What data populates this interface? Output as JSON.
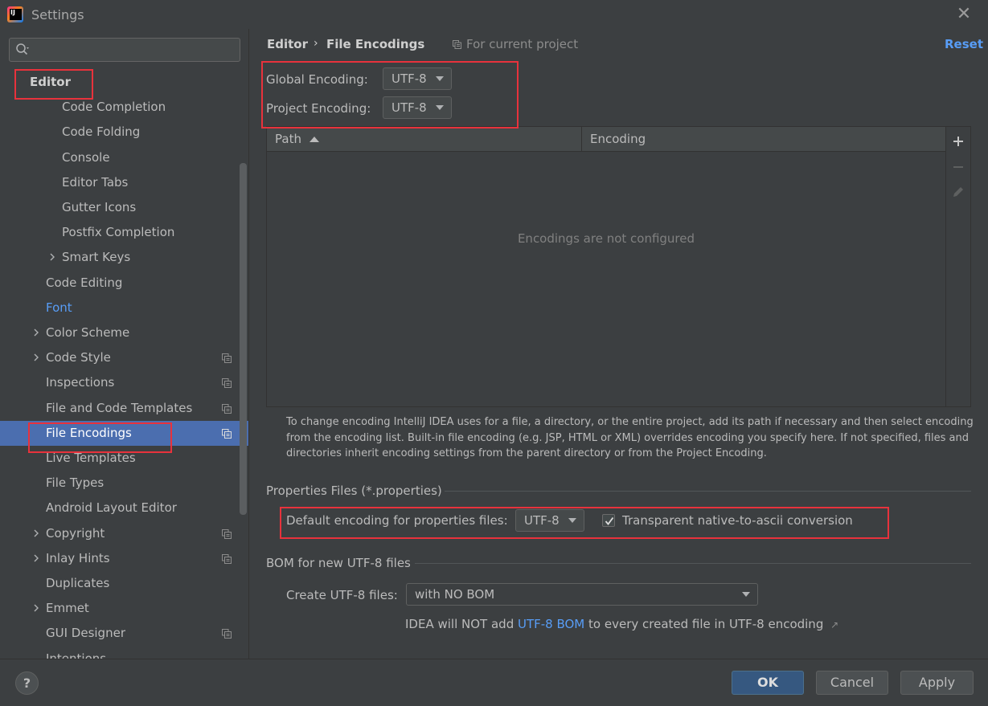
{
  "window": {
    "title": "Settings",
    "icon": "intellij-idea-icon",
    "close_icon": "close-icon"
  },
  "sidebar": {
    "search_placeholder": "",
    "root": "Editor",
    "items": [
      {
        "label": "Code Completion",
        "level": 2
      },
      {
        "label": "Code Folding",
        "level": 2
      },
      {
        "label": "Console",
        "level": 2
      },
      {
        "label": "Editor Tabs",
        "level": 2
      },
      {
        "label": "Gutter Icons",
        "level": 2
      },
      {
        "label": "Postfix Completion",
        "level": 2
      },
      {
        "label": "Smart Keys",
        "level": 2,
        "expandable": true
      },
      {
        "label": "Code Editing",
        "level": 1
      },
      {
        "label": "Font",
        "level": 1,
        "link": true
      },
      {
        "label": "Color Scheme",
        "level": 1,
        "expandable": true
      },
      {
        "label": "Code Style",
        "level": 1,
        "expandable": true,
        "project": true
      },
      {
        "label": "Inspections",
        "level": 1,
        "project": true
      },
      {
        "label": "File and Code Templates",
        "level": 1,
        "project": true
      },
      {
        "label": "File Encodings",
        "level": 1,
        "project": true,
        "selected": true
      },
      {
        "label": "Live Templates",
        "level": 1
      },
      {
        "label": "File Types",
        "level": 1
      },
      {
        "label": "Android Layout Editor",
        "level": 1
      },
      {
        "label": "Copyright",
        "level": 1,
        "expandable": true,
        "project": true
      },
      {
        "label": "Inlay Hints",
        "level": 1,
        "expandable": true,
        "project": true
      },
      {
        "label": "Duplicates",
        "level": 1
      },
      {
        "label": "Emmet",
        "level": 1,
        "expandable": true
      },
      {
        "label": "GUI Designer",
        "level": 1,
        "project": true
      },
      {
        "label": "Intentions",
        "level": 1
      }
    ]
  },
  "header": {
    "breadcrumb_parent": "Editor",
    "breadcrumb_separator": "›",
    "breadcrumb_current": "File Encodings",
    "scope": "For current project",
    "reset": "Reset"
  },
  "encodings": {
    "global_label": "Global Encoding:",
    "global_value": "UTF-8",
    "project_label": "Project Encoding:",
    "project_value": "UTF-8"
  },
  "table": {
    "columns": [
      "Path",
      "Encoding"
    ],
    "empty_text": "Encodings are not configured",
    "toolbar": [
      "add-icon",
      "remove-icon",
      "edit-icon"
    ]
  },
  "help_text": "To change encoding IntelliJ IDEA uses for a file, a directory, or the entire project, add its path if necessary and then select encoding from the encoding list. Built-in file encoding (e.g. JSP, HTML or XML) overrides encoding you specify here. If not specified, files and directories inherit encoding settings from the parent directory or from the Project Encoding.",
  "properties": {
    "section_title": "Properties Files (*.properties)",
    "default_label": "Default encoding for properties files:",
    "default_value": "UTF-8",
    "native_to_ascii_label": "Transparent native-to-ascii conversion",
    "native_to_ascii_checked": true
  },
  "bom": {
    "section_title": "BOM for new UTF-8 files",
    "create_label": "Create UTF-8 files:",
    "create_value": "with NO BOM",
    "info_prefix": "IDEA will NOT add ",
    "info_link": "UTF-8 BOM",
    "info_suffix": " to every created file in UTF-8 encoding"
  },
  "buttons": {
    "help": "?",
    "ok": "OK",
    "cancel": "Cancel",
    "apply": "Apply"
  },
  "colors": {
    "background": "#3c3f41",
    "selection": "#4b6eaf",
    "link": "#589df6",
    "highlight_box": "#e8323c",
    "default_button": "#365880"
  }
}
